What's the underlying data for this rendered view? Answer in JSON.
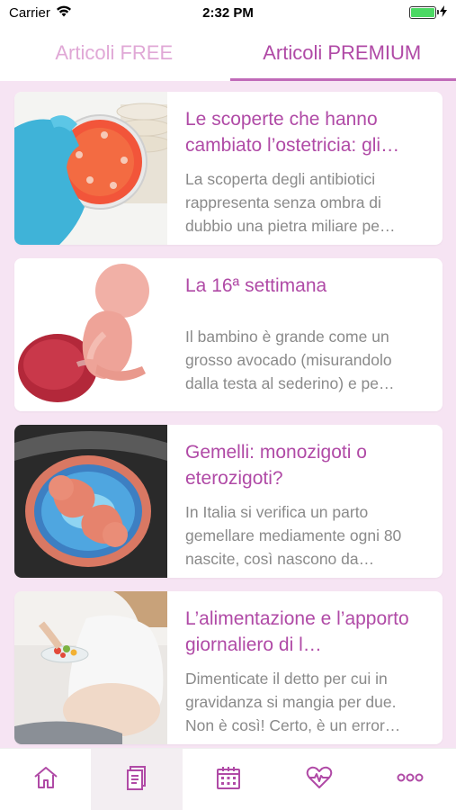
{
  "status": {
    "carrier": "Carrier",
    "time": "2:32 PM"
  },
  "tabs": [
    {
      "label": "Articoli FREE",
      "active": false
    },
    {
      "label": "Articoli PREMIUM",
      "active": true
    }
  ],
  "articles": [
    {
      "title": "Le scoperte che hanno cambiato l’ostetricia: gli…",
      "excerpt": "La scoperta degli antibiotici rappresenta senza ombra di dubbio una pietra miliare pe…"
    },
    {
      "title": "La 16ª settimana",
      "excerpt": "Il bambino è grande come un grosso avocado (misurandolo dalla testa al sederino) e pe…"
    },
    {
      "title": "Gemelli: monozigoti o eterozigoti?",
      "excerpt": "In Italia si verifica un parto gemellare mediamente ogni 80 nascite, così nascono da…"
    },
    {
      "title": "L’alimentazione e l’apporto giornaliero di l…",
      "excerpt": "Dimenticate il detto per cui in gravidanza si mangia per due. Non è così! Certo, è un error…"
    }
  ],
  "bottom_nav": [
    {
      "icon": "home-icon",
      "active": false
    },
    {
      "icon": "articles-icon",
      "active": true
    },
    {
      "icon": "calendar-icon",
      "active": false
    },
    {
      "icon": "heart-monitor-icon",
      "active": false
    },
    {
      "icon": "more-icon",
      "active": false
    }
  ],
  "colors": {
    "accent": "#b04aa6",
    "tab_inactive": "#e0a8d6",
    "background": "#f6e4f3",
    "excerpt": "#8a8a8a"
  }
}
